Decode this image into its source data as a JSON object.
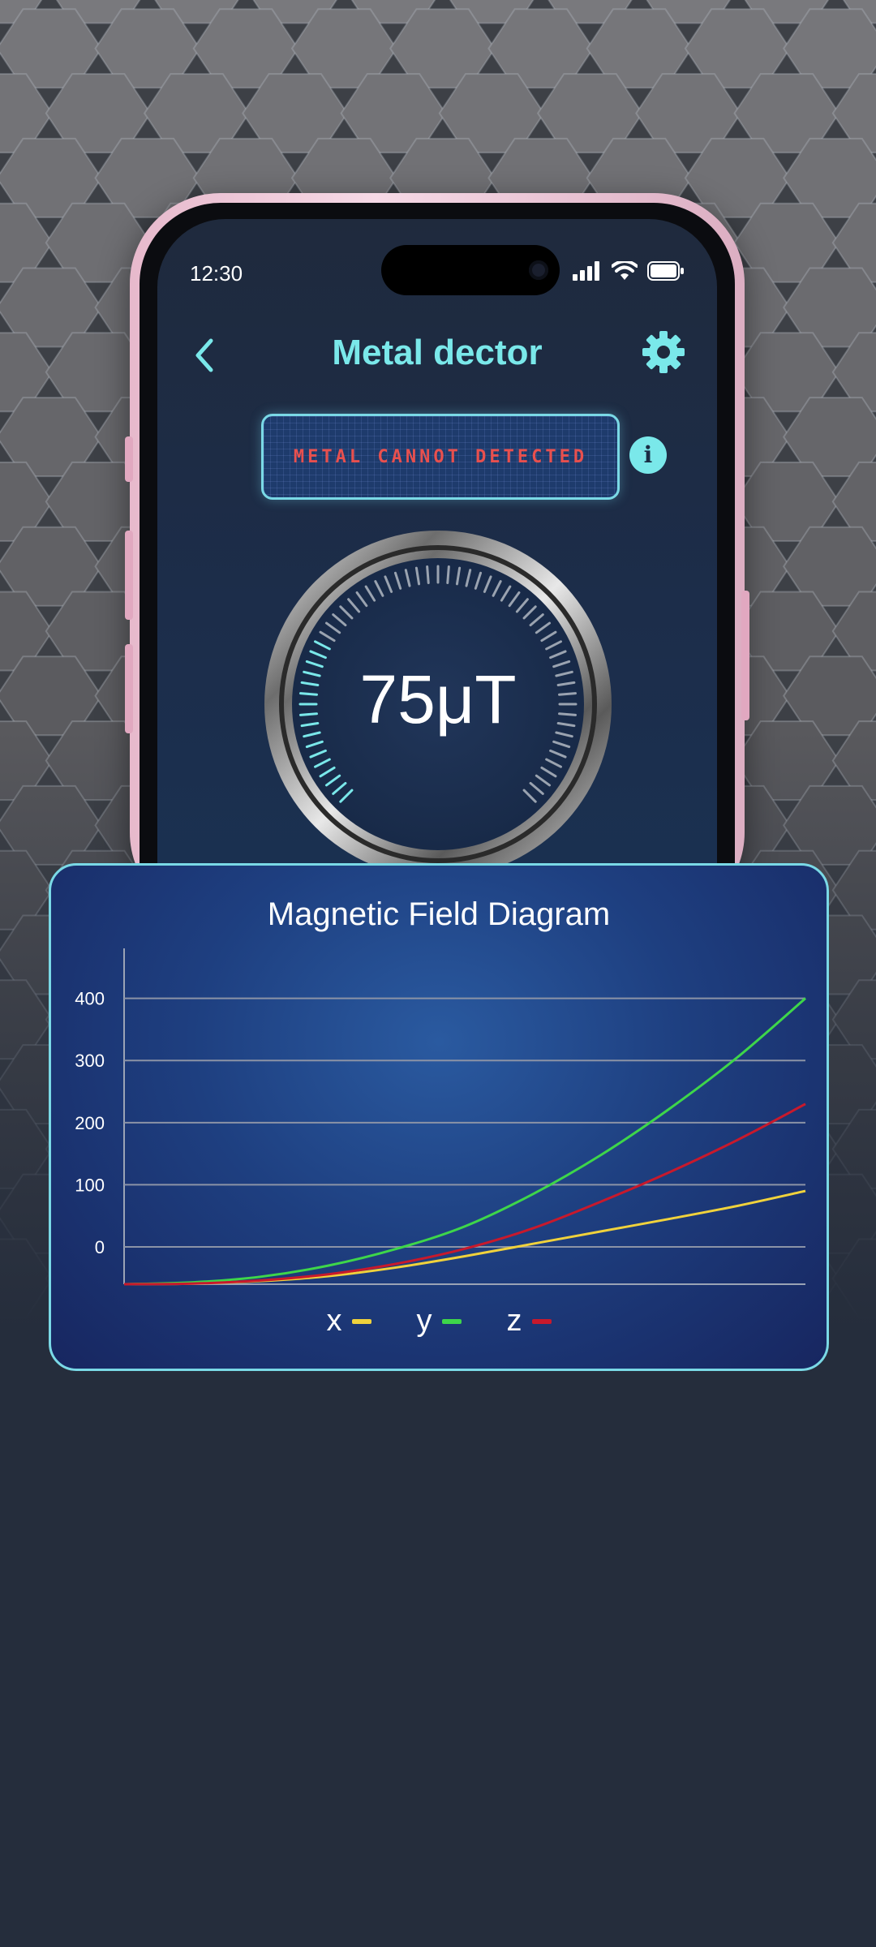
{
  "status_bar": {
    "time": "12:30"
  },
  "header": {
    "title": "Metal dector",
    "back_icon": "chevron-left-icon",
    "settings_icon": "gear-icon"
  },
  "banner": {
    "text": "METAL CANNOT DETECTED",
    "info_label": "i"
  },
  "gauge": {
    "value_text": "75μT",
    "level_fraction": 0.27
  },
  "colors": {
    "accent": "#7ae8ea",
    "banner_text": "#e8504e",
    "series_x": "#f0d23c",
    "series_y": "#3ed64a",
    "series_z": "#c8192c"
  },
  "chart_data": {
    "type": "line",
    "title": "Magnetic Field Diagram",
    "xlabel": "",
    "ylabel": "",
    "x": [
      0,
      1,
      2,
      3,
      4,
      5,
      6,
      7,
      8,
      9,
      10
    ],
    "ylim": [
      -60,
      470
    ],
    "yticks": [
      0,
      100,
      200,
      300,
      400
    ],
    "grid": true,
    "legend_position": "bottom",
    "series": [
      {
        "name": "x",
        "color": "#f0d23c",
        "values": [
          -60,
          -59,
          -55,
          -47,
          -33,
          -15,
          5,
          25,
          45,
          66,
          90
        ]
      },
      {
        "name": "y",
        "color": "#3ed64a",
        "values": [
          -60,
          -57,
          -48,
          -30,
          -3,
          33,
          85,
          148,
          222,
          305,
          400
        ]
      },
      {
        "name": "z",
        "color": "#c8192c",
        "values": [
          -60,
          -59,
          -54,
          -44,
          -27,
          -3,
          30,
          73,
          120,
          172,
          230
        ]
      }
    ]
  }
}
